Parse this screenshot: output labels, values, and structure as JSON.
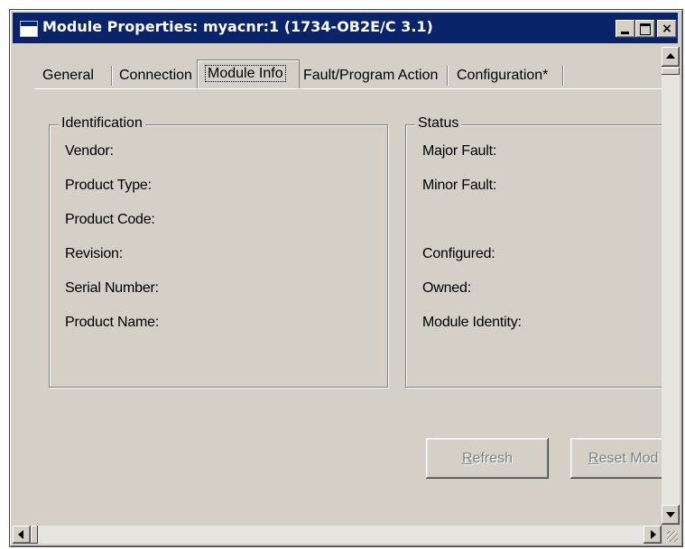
{
  "window": {
    "title": "Module Properties: myacnr:1 (1734-OB2E/C 3.1)",
    "controls": {
      "minimize": "_",
      "maximize": "□",
      "close": "×"
    }
  },
  "tabs": [
    {
      "label": "General"
    },
    {
      "label": "Connection"
    },
    {
      "label": "Module Info",
      "selected": true
    },
    {
      "label": "Fault/Program Action"
    },
    {
      "label": "Configuration*"
    }
  ],
  "identification": {
    "legend": "Identification",
    "fields": [
      "Vendor:",
      "Product Type:",
      "Product Code:",
      "Revision:",
      "Serial Number:",
      "Product Name:"
    ]
  },
  "status": {
    "legend": "Status",
    "fields": [
      "Major Fault:",
      "Minor Fault:",
      "Configured:",
      "Owned:",
      "Module Identity:"
    ]
  },
  "buttons": {
    "refresh": {
      "mnemonic": "R",
      "rest": "efresh",
      "enabled": false
    },
    "reset": {
      "mnemonic": "R",
      "rest": "eset Mod",
      "enabled": false
    }
  },
  "colors": {
    "titlebar": "#0a246a",
    "face": "#d4d0c8",
    "disabled_text": "#808080"
  }
}
